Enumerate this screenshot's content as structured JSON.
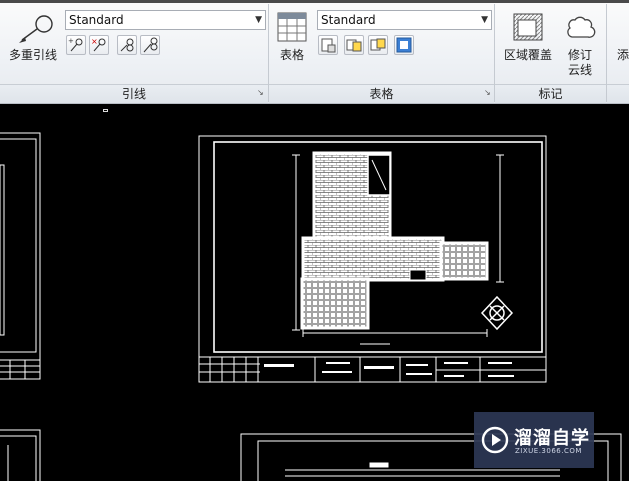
{
  "ribbon": {
    "leader_panel": {
      "multileader_button": "多重引线",
      "style_combo": "Standard",
      "panel_title": "引线"
    },
    "table_panel": {
      "table_button": "表格",
      "style_combo": "Standard",
      "panel_title": "表格"
    },
    "markup_panel": {
      "wipeout_button": "区域覆盖",
      "revcloud_button": "修订云线",
      "panel_title": "标记"
    },
    "overflow_button": "添"
  },
  "watermark": {
    "brand": "溜溜自学",
    "url": "ZIXUE.3066.COM"
  },
  "colors": {
    "ribbon_bg": "#eef1f5",
    "canvas_bg": "#000000",
    "drawing_lines": "#ffffff",
    "watermark_bg": "#2d3755"
  }
}
